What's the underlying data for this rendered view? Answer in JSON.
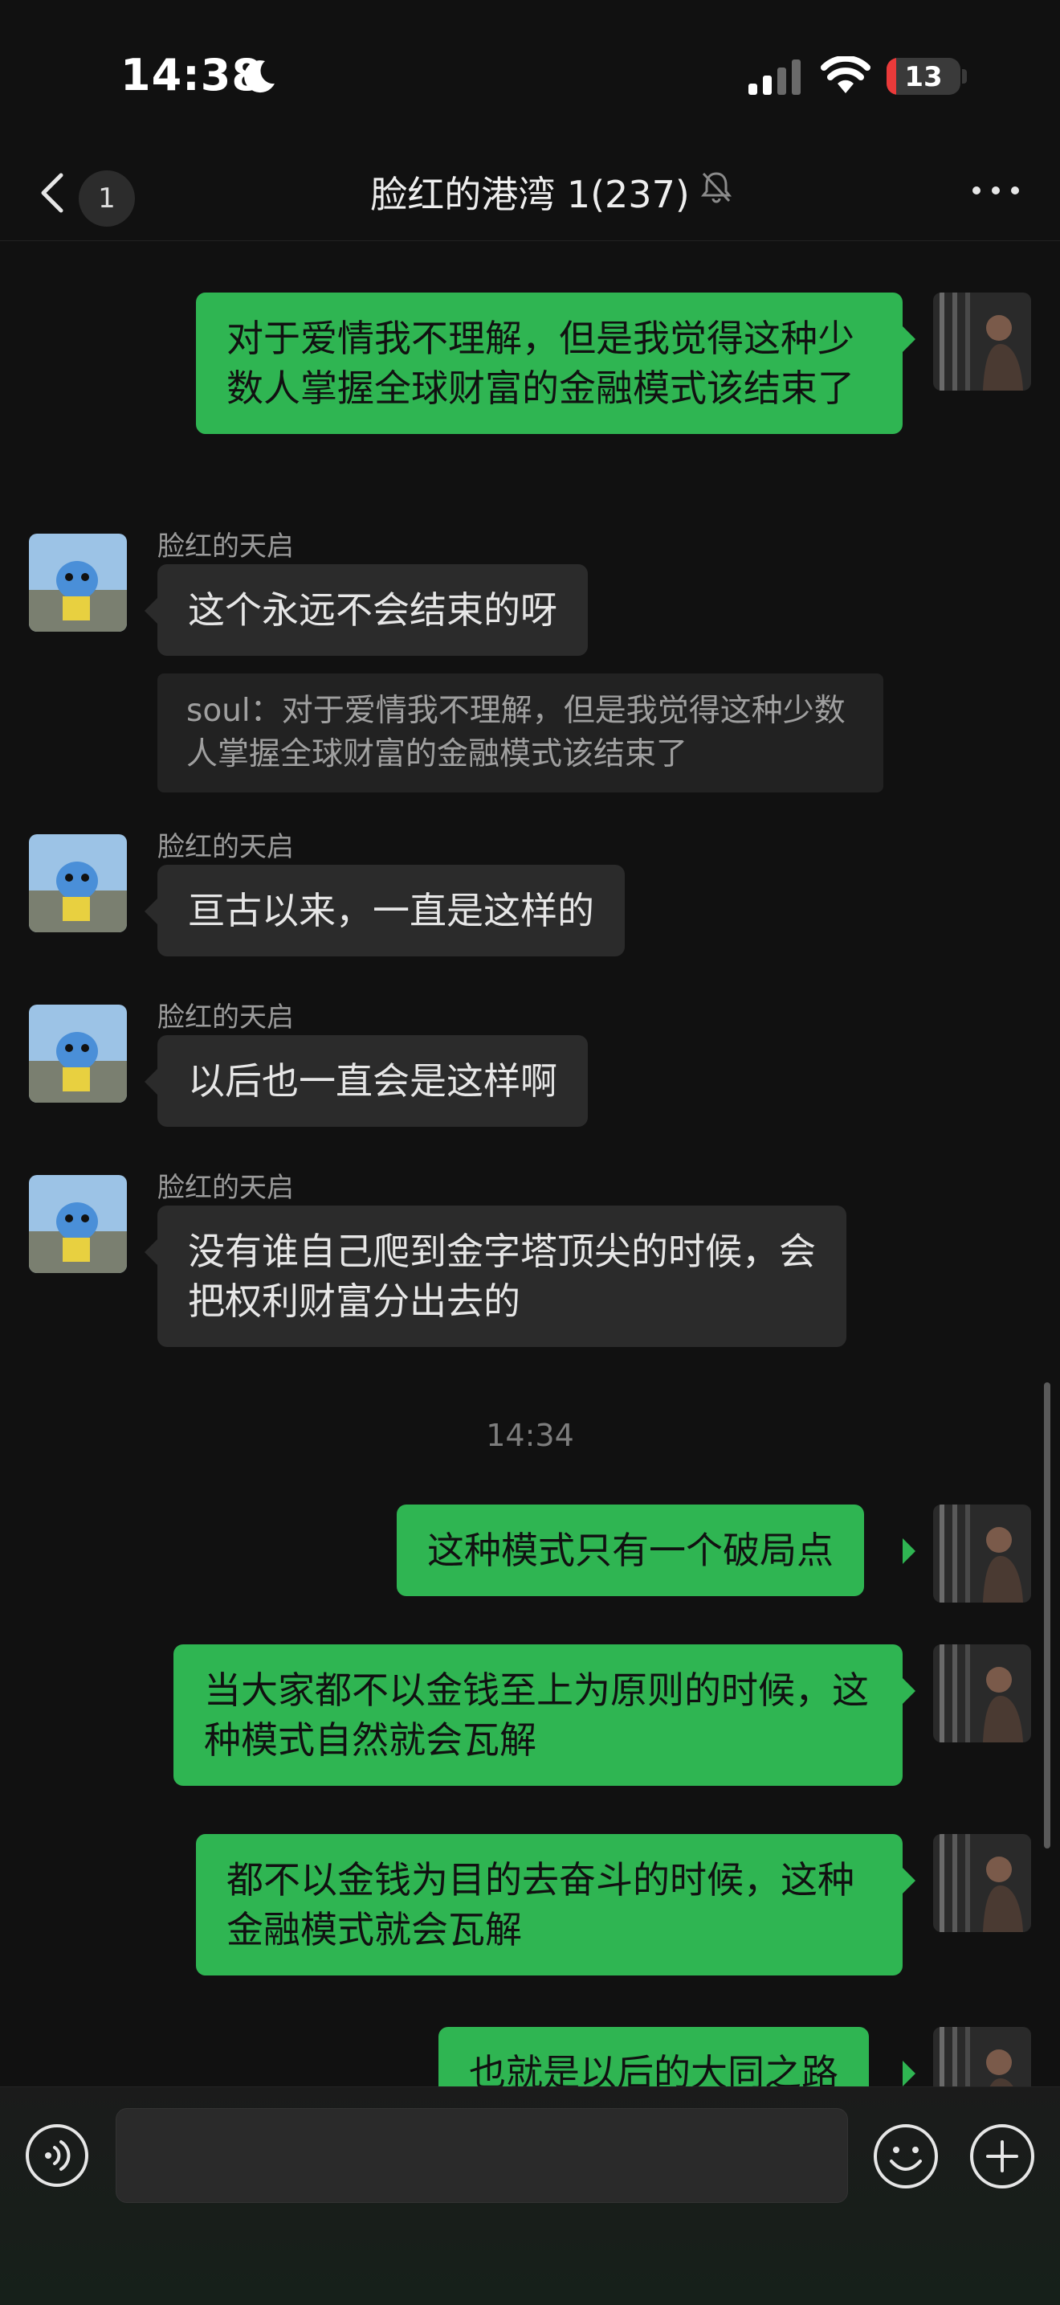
{
  "status_bar": {
    "time": "14:38",
    "battery_level": "13",
    "battery_fraction": 0.13,
    "colors": {
      "battery_low": "#ea3a3a"
    }
  },
  "nav": {
    "back_icon": "chevron-left-icon",
    "unread_count": "1",
    "title": "脸红的港湾 1(237)",
    "mute_icon": "bell-off-icon",
    "more_icon": "more-horizontal-icon"
  },
  "messages": [
    {
      "from": "me",
      "text": "对于爱情我不理解，但是我觉得这种少数人掌握全球财富的金融模式该结束了"
    },
    {
      "from": "other",
      "sender": "脸红的天启",
      "text": "这个永远不会结束的呀",
      "quote": "soul：对于爱情我不理解，但是我觉得这种少数人掌握全球财富的金融模式该结束了"
    },
    {
      "from": "other",
      "sender": "脸红的天启",
      "text": "亘古以来，一直是这样的"
    },
    {
      "from": "other",
      "sender": "脸红的天启",
      "text": "以后也一直会是这样啊"
    },
    {
      "from": "other",
      "sender": "脸红的天启",
      "text": "没有谁自己爬到金字塔顶尖的时候，会把权利财富分出去的"
    },
    {
      "from": "me",
      "text": "这种模式只有一个破局点"
    },
    {
      "from": "me",
      "text": "当大家都不以金钱至上为原则的时候，这种模式自然就会瓦解"
    },
    {
      "from": "me",
      "text": "都不以金钱为目的去奋斗的时候，这种金融模式就会瓦解"
    },
    {
      "from": "me",
      "text": "也就是以后的大同之路"
    }
  ],
  "time_divider": "14:34",
  "input_bar": {
    "voice_icon": "voice-icon",
    "emoji_icon": "emoji-icon",
    "add_icon": "plus-circle-icon",
    "input_value": ""
  },
  "colors": {
    "background": "#111111",
    "my_bubble": "#2fb552",
    "other_bubble": "#2b2b2b"
  }
}
